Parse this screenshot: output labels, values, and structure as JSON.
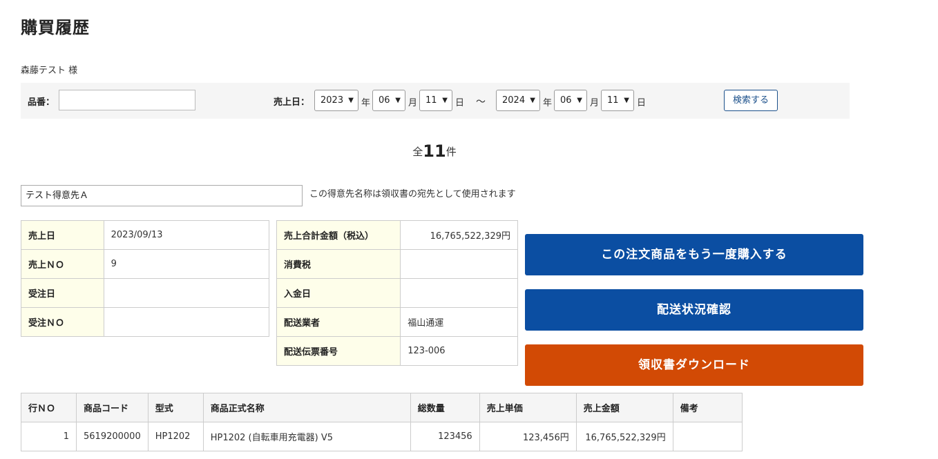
{
  "page": {
    "title": "購買履歴",
    "customer_name": "森藤テスト 様"
  },
  "search": {
    "part_no_label": "品番：",
    "part_no_value": "",
    "sales_date_label": "売上日：",
    "from": {
      "year": "2023",
      "month": "06",
      "day": "11"
    },
    "to": {
      "year": "2024",
      "month": "06",
      "day": "11"
    },
    "unit_year": "年",
    "unit_month": "月",
    "unit_day": "日",
    "range_sep": "〜",
    "search_button": "検索する"
  },
  "total": {
    "prefix": "全",
    "count": "11",
    "suffix": "件"
  },
  "recipient": {
    "value": "テスト得意先Ａ",
    "note": "この得意先名称は領収書の宛先として使用されます"
  },
  "order_info_left": [
    {
      "label": "売上日",
      "value": "2023/09/13"
    },
    {
      "label": "売上ＮＯ",
      "value": "9"
    },
    {
      "label": "受注日",
      "value": ""
    },
    {
      "label": "受注ＮＯ",
      "value": ""
    }
  ],
  "order_info_right": [
    {
      "label": "売上合計金額（税込）",
      "value": "16,765,522,329円"
    },
    {
      "label": "消費税",
      "value": ""
    },
    {
      "label": "入金日",
      "value": ""
    },
    {
      "label": "配送業者",
      "value": "福山通運"
    },
    {
      "label": "配送伝票番号",
      "value": "123-006"
    }
  ],
  "actions": {
    "reorder": "この注文商品をもう一度購入する",
    "shipping_status": "配送状況確認",
    "receipt_download": "領収書ダウンロード"
  },
  "colors": {
    "primary_blue": "#0b4ea2",
    "accent_orange": "#d24a05",
    "label_bg": "#fefeea"
  },
  "items_table": {
    "headers": [
      "行ＮＯ",
      "商品コード",
      "型式",
      "商品正式名称",
      "総数量",
      "売上単価",
      "売上金額",
      "備考"
    ],
    "rows": [
      [
        "1",
        "5619200000",
        "HP1202",
        "HP1202 (自転車用充電器) V5",
        "123456",
        "123,456円",
        "16,765,522,329円",
        ""
      ]
    ]
  }
}
